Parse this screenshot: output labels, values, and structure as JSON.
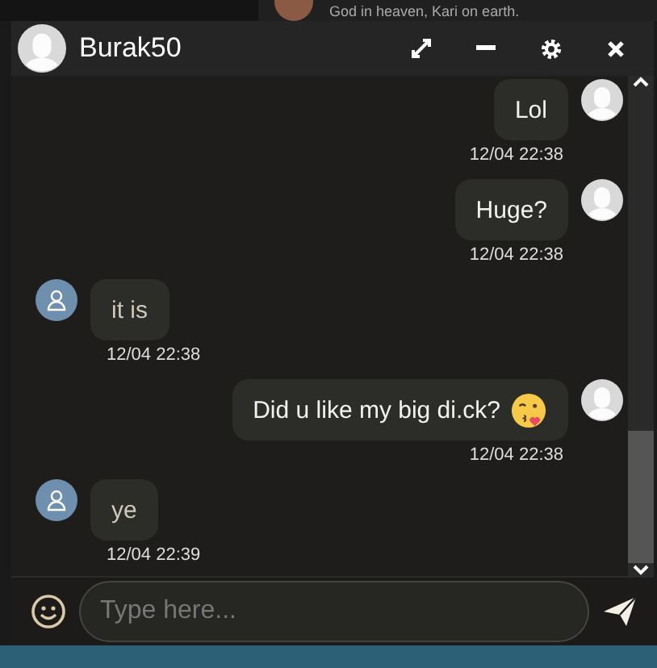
{
  "background_post": {
    "text": "God in heaven, Kari on earth."
  },
  "window": {
    "title": "Burak50"
  },
  "messages": [
    {
      "kind": "outgoing",
      "text": "Lol",
      "time": "12/04 22:38",
      "has_emoji": false
    },
    {
      "kind": "outgoing",
      "text": "Huge?",
      "time": "12/04 22:38",
      "has_emoji": false
    },
    {
      "kind": "incoming",
      "text": "it is",
      "time": "12/04 22:38",
      "has_emoji": false
    },
    {
      "kind": "outgoing",
      "text": "Did u like my big di.ck?",
      "time": "12/04 22:38",
      "has_emoji": true
    },
    {
      "kind": "incoming",
      "text": "ye",
      "time": "12/04 22:39",
      "has_emoji": false
    }
  ],
  "composer": {
    "placeholder": "Type here..."
  }
}
